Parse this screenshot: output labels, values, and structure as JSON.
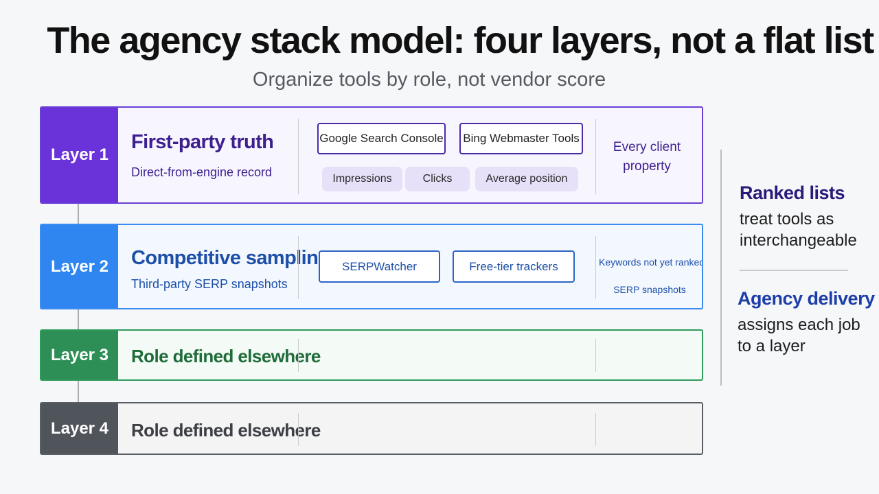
{
  "header": {
    "title": "The agency stack model: four layers, not a flat list",
    "subtitle": "Organize tools by role, not vendor score"
  },
  "colors": {
    "layer1": "#6a32d9",
    "layer2": "#2f86f0",
    "layer3": "#2e8f56",
    "layer4": "#50555c",
    "accent_navy": "#1d3ea8"
  },
  "layers": [
    {
      "badge": "Layer 1",
      "title": "First-party truth",
      "subtitle": "Direct-from-engine record",
      "tools": [
        "Google Search Console",
        "Bing Webmaster Tools"
      ],
      "metrics": [
        "Impressions",
        "Clicks",
        "Average position"
      ],
      "scope": [
        "Every client",
        "property"
      ]
    },
    {
      "badge": "Layer 2",
      "title": "Competitive sampling",
      "subtitle": "Third-party SERP snapshots",
      "tools": [
        "SERPWatcher",
        "Free-tier trackers"
      ],
      "scope": [
        "Keywords not yet ranked",
        "SERP snapshots"
      ]
    },
    {
      "badge": "Layer 3",
      "title": "Role defined elsewhere"
    },
    {
      "badge": "Layer 4",
      "title": "Role defined elsewhere"
    }
  ],
  "sidebar": {
    "ranked_heading": "Ranked lists",
    "ranked_lines": [
      "treat tools as",
      "interchangeable"
    ],
    "agency_heading": "Agency delivery",
    "agency_lines": [
      "assigns each job",
      "to a layer"
    ]
  }
}
